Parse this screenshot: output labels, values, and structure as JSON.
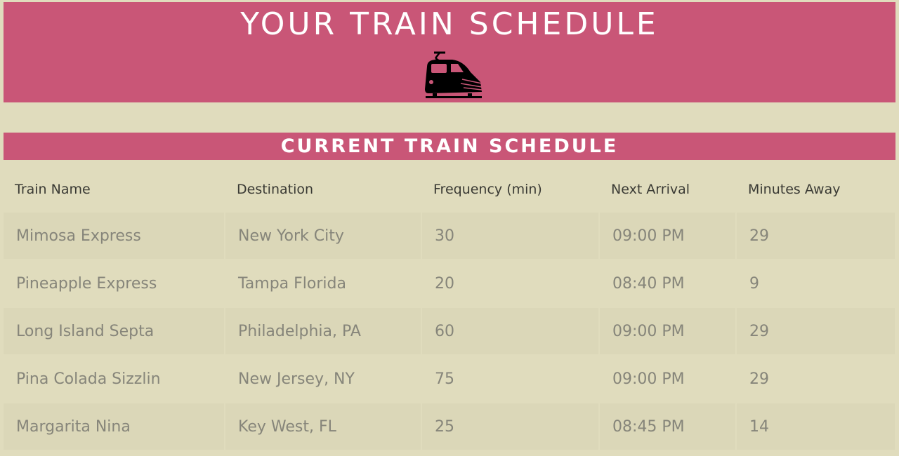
{
  "header": {
    "title": "YOUR TRAIN SCHEDULE",
    "icon": "train-icon"
  },
  "section": {
    "title": "CURRENT TRAIN SCHEDULE"
  },
  "table": {
    "columns": [
      "Train Name",
      "Destination",
      "Frequency (min)",
      "Next Arrival",
      "Minutes Away"
    ],
    "rows": [
      {
        "name": "Mimosa Express",
        "destination": "New York City",
        "frequency": "30",
        "next_arrival": "09:00 PM",
        "minutes_away": "29"
      },
      {
        "name": "Pineapple Express",
        "destination": "Tampa Florida",
        "frequency": "20",
        "next_arrival": "08:40 PM",
        "minutes_away": "9"
      },
      {
        "name": "Long Island Septa",
        "destination": "Philadelphia, PA",
        "frequency": "60",
        "next_arrival": "09:00 PM",
        "minutes_away": "29"
      },
      {
        "name": "Pina Colada Sizzlin",
        "destination": "New Jersey, NY",
        "frequency": "75",
        "next_arrival": "09:00 PM",
        "minutes_away": "29"
      },
      {
        "name": "Margarita Nina",
        "destination": "Key West, FL",
        "frequency": "25",
        "next_arrival": "08:45 PM",
        "minutes_away": "14"
      }
    ]
  },
  "colors": {
    "background": "#e0dcbd",
    "banner": "#c95677",
    "row_stripe": "#dbd7b8",
    "cell_text": "#86857a",
    "header_text": "#3a3a34"
  }
}
